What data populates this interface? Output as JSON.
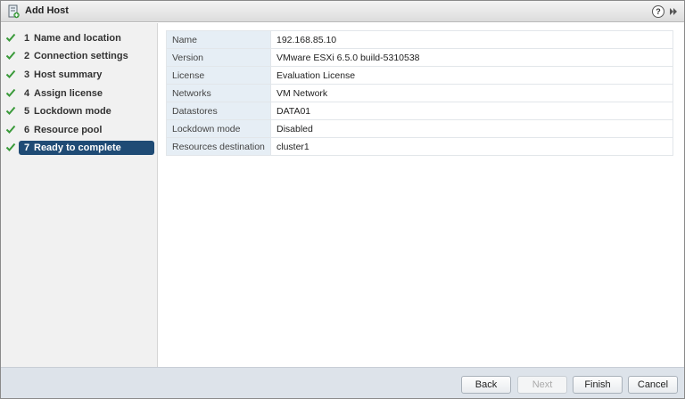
{
  "window": {
    "title": "Add Host",
    "help_label": "?"
  },
  "sidebar": {
    "steps": [
      {
        "num": "1",
        "label": "Name and location"
      },
      {
        "num": "2",
        "label": "Connection settings"
      },
      {
        "num": "3",
        "label": "Host summary"
      },
      {
        "num": "4",
        "label": "Assign license"
      },
      {
        "num": "5",
        "label": "Lockdown mode"
      },
      {
        "num": "6",
        "label": "Resource pool"
      },
      {
        "num": "7",
        "label": "Ready to complete"
      }
    ],
    "active_step": 7
  },
  "summary": {
    "rows": [
      {
        "key": "Name",
        "value": "192.168.85.10"
      },
      {
        "key": "Version",
        "value": "VMware ESXi 6.5.0 build-5310538"
      },
      {
        "key": "License",
        "value": "Evaluation License"
      },
      {
        "key": "Networks",
        "value": "VM Network"
      },
      {
        "key": "Datastores",
        "value": "DATA01"
      },
      {
        "key": "Lockdown mode",
        "value": "Disabled"
      },
      {
        "key": "Resources destination",
        "value": "cluster1"
      }
    ]
  },
  "footer": {
    "back_label": "Back",
    "next_label": "Next",
    "finish_label": "Finish",
    "cancel_label": "Cancel"
  },
  "colors": {
    "active_step_bg": "#1f4b75",
    "check_green": "#3a9a3a",
    "footer_bg": "#dde3ea"
  }
}
